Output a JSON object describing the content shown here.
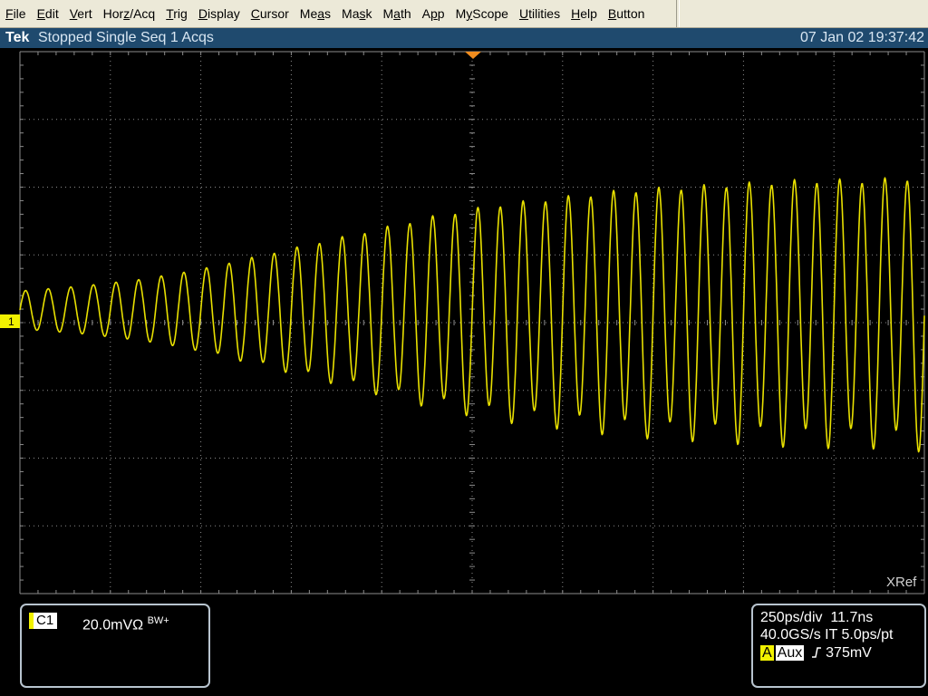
{
  "menu": {
    "items": [
      {
        "label": "File",
        "mnemonic_index": 0
      },
      {
        "label": "Edit",
        "mnemonic_index": 0
      },
      {
        "label": "Vert",
        "mnemonic_index": 0
      },
      {
        "label": "Horz/Acq",
        "mnemonic_index": 3
      },
      {
        "label": "Trig",
        "mnemonic_index": 0
      },
      {
        "label": "Display",
        "mnemonic_index": 0
      },
      {
        "label": "Cursor",
        "mnemonic_index": 0
      },
      {
        "label": "Meas",
        "mnemonic_index": 2
      },
      {
        "label": "Mask",
        "mnemonic_index": 2
      },
      {
        "label": "Math",
        "mnemonic_index": 1
      },
      {
        "label": "App",
        "mnemonic_index": 1
      },
      {
        "label": "MyScope",
        "mnemonic_index": 1
      },
      {
        "label": "Utilities",
        "mnemonic_index": 0
      },
      {
        "label": "Help",
        "mnemonic_index": 0
      },
      {
        "label": "Button",
        "mnemonic_index": 0
      }
    ]
  },
  "status": {
    "brand": "Tek",
    "acquisition": "Stopped Single Seq 1 Acqs",
    "datetime": "07 Jan 02 19:37:42"
  },
  "screen": {
    "xref_label": "XRef",
    "ch1_marker": "1",
    "colors": {
      "trace": "#e8e000",
      "grid": "#8c8c8c",
      "trigger_marker": "#f08c1e",
      "status_bar": "#1f4a6e"
    }
  },
  "channel1": {
    "name": "C1",
    "scale": "20.0mVΩ",
    "bandwidth": "BW+"
  },
  "horizontal": {
    "timebase": "250ps/div",
    "position": "11.7ns",
    "sample_rate": "40.0GS/s IT 5.0ps/pt",
    "trigger_label": "A",
    "trigger_source": "Aux",
    "trigger_slope_icon": "rising-edge-icon",
    "trigger_level": "375mV"
  },
  "waveform": {
    "description_free": true,
    "cycles": 40,
    "envelope_divisions": [
      0.28,
      0.35,
      0.45,
      0.6,
      0.8,
      1.0,
      1.2,
      1.4,
      1.55,
      1.65,
      1.75,
      1.8,
      1.85,
      1.9,
      1.9,
      1.95
    ]
  }
}
